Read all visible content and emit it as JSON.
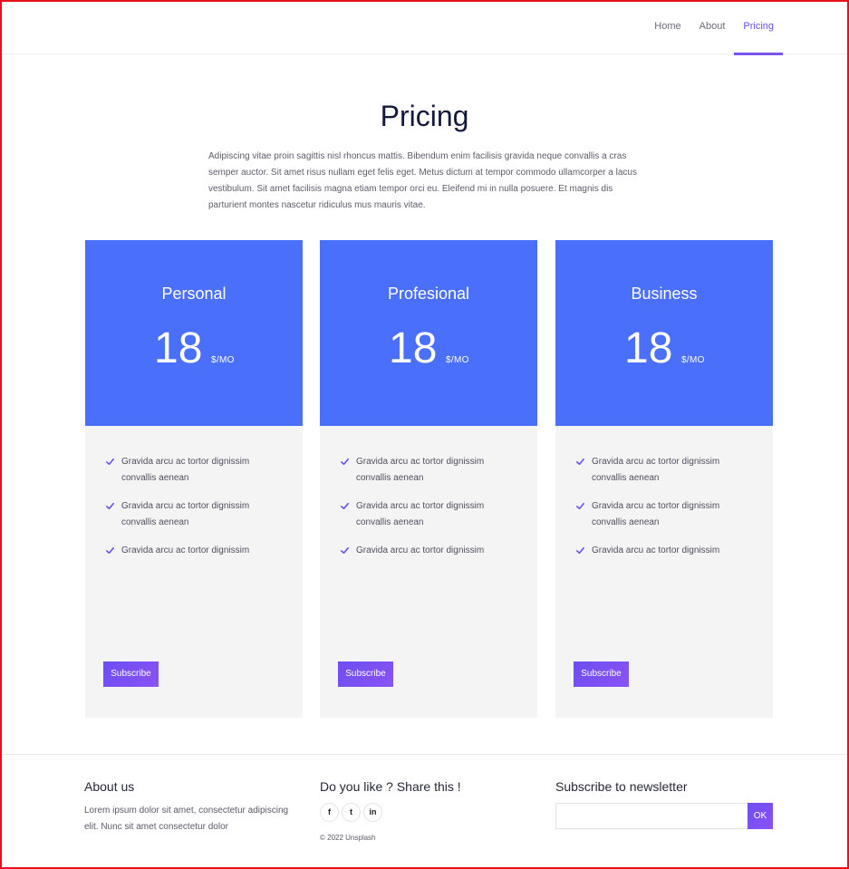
{
  "nav": {
    "items": [
      {
        "label": "Home"
      },
      {
        "label": "About"
      },
      {
        "label": "Pricing"
      }
    ],
    "active": "Pricing"
  },
  "hero": {
    "title": "Pricing",
    "text": "Adipiscing vitae proin sagittis nisl rhoncus mattis. Bibendum enim facilisis gravida neque convallis a cras semper auctor. Sit amet risus nullam eget felis eget. Metus dictum at tempor commodo ullamcorper a lacus vestibulum. Sit amet facilisis magna etiam tempor orci eu. Eleifend mi in nulla posuere. Et magnis dis parturient montes nascetur ridiculus mus mauris vitae."
  },
  "plans": [
    {
      "name": "Personal",
      "price": "18",
      "per": "$/MO",
      "features": [
        "Gravida arcu ac tortor dignissim convallis aenean",
        "Gravida arcu ac tortor dignissim convallis aenean",
        "Gravida arcu ac tortor dignissim"
      ],
      "button": "Subscribe"
    },
    {
      "name": "Profesional",
      "price": "18",
      "per": "$/MO",
      "features": [
        "Gravida arcu ac tortor dignissim convallis aenean",
        "Gravida arcu ac tortor dignissim convallis aenean",
        "Gravida arcu ac tortor dignissim"
      ],
      "button": "Subscribe"
    },
    {
      "name": "Business",
      "price": "18",
      "per": "$/MO",
      "features": [
        "Gravida arcu ac tortor dignissim convallis aenean",
        "Gravida arcu ac tortor dignissim convallis aenean",
        "Gravida arcu ac tortor dignissim"
      ],
      "button": "Subscribe"
    }
  ],
  "footer": {
    "about": {
      "title": "About us",
      "text": "Lorem ipsum dolor sit amet, consectetur adipiscing elit. Nunc sit amet consectetur dolor"
    },
    "share": {
      "title": "Do you like ? Share this !",
      "icons": [
        {
          "name": "facebook-icon",
          "glyph": "f"
        },
        {
          "name": "twitter-icon",
          "glyph": "t"
        },
        {
          "name": "linkedin-icon",
          "glyph": "in"
        }
      ],
      "copyright": "© 2022 Unsplash"
    },
    "newsletter": {
      "title": "Subscribe to newsletter",
      "placeholder": "",
      "button": "OK"
    }
  },
  "colors": {
    "accent": "#7b55f0",
    "card_header": "#4a6ffb",
    "card_body": "#f4f4f5",
    "frame_border": "#e8101b"
  }
}
